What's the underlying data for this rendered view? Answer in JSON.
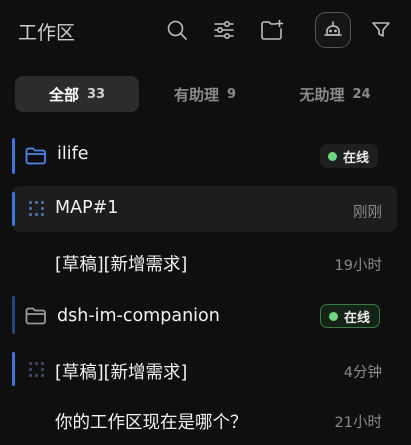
{
  "header": {
    "title": "工作区",
    "icons": [
      "search-icon",
      "sliders-icon",
      "new-folder-icon",
      "robot-icon",
      "filter-icon"
    ]
  },
  "tabs": [
    {
      "label": "全部",
      "count": "33",
      "active": true
    },
    {
      "label": "有助理",
      "count": "9",
      "active": false
    },
    {
      "label": "无助理",
      "count": "24",
      "active": false
    }
  ],
  "workspaces": [
    {
      "name": "ilife",
      "status": "在线",
      "items": [
        {
          "title": "MAP#1",
          "time": "刚刚",
          "selected": true
        },
        {
          "title": "[草稿][新增需求]",
          "time": "19小时"
        }
      ]
    },
    {
      "name": "dsh-im-companion",
      "status": "在线",
      "items": [
        {
          "title": "[草稿][新增需求]",
          "time": "4分钟"
        },
        {
          "title": "你的工作区现在是哪个？",
          "time": "21小时"
        }
      ]
    }
  ],
  "colors": {
    "accent": "#3b74e0",
    "online": "#6dd67f",
    "background": "#0f0f0f"
  }
}
